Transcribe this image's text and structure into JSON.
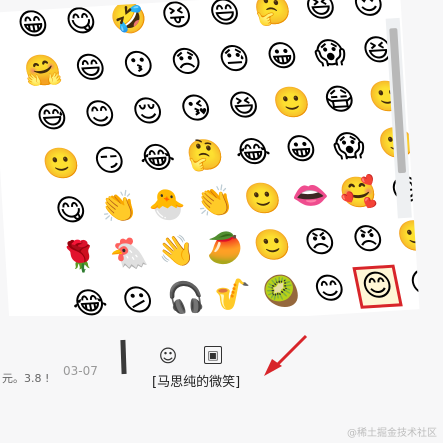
{
  "emoji_panel": {
    "rows": [
      [
        "😁",
        "😋",
        "🤣",
        "😝",
        "😄",
        "🤔",
        "😆",
        "😍"
      ],
      [
        "🤗",
        "😄",
        "😗",
        "😞",
        "😓",
        "😀",
        "😱",
        "😆"
      ],
      [
        "😅",
        "😊",
        "😌",
        "😘",
        "😆",
        "🙂",
        "😷",
        "🙂"
      ],
      [
        "🙂",
        "😏",
        "😂",
        "🤔",
        "😂",
        "😀",
        "😱",
        "🙂"
      ],
      [
        "😋",
        "👏",
        "🐣",
        "👏",
        "🙂",
        "👄",
        "🥰",
        "😄"
      ],
      [
        "🌹",
        "🐔",
        "👋",
        "🥭",
        "🙂",
        "😠",
        "😠",
        "🙂"
      ],
      [
        "😂",
        "😕",
        "🎧",
        "🎷",
        "🥝",
        "😊",
        "😊",
        "😐"
      ]
    ],
    "selected_index": "6-6",
    "selected_label": "[马思纯的微笑]"
  },
  "colors": {
    "highlight_red": "#d8252a",
    "scroll_thumb": "#b8b8b8"
  },
  "chat": {
    "timestamp": "03-07",
    "side_text": "元。3.8 !",
    "inserted_text": "[马思纯的微笑]",
    "watermark": "@稀土掘金技术社区"
  },
  "toolbar": {
    "emoji_icon": "smiley-icon",
    "image_icon": "image-icon"
  }
}
